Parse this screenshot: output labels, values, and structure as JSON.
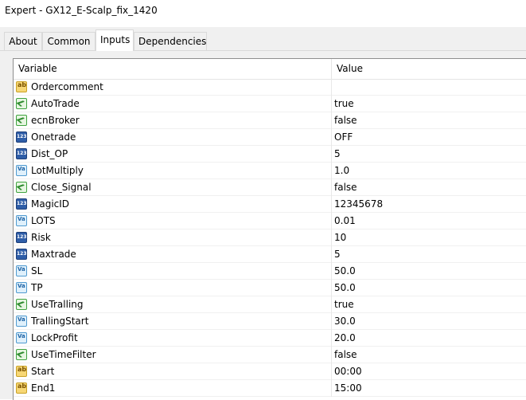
{
  "window": {
    "title": "Expert - GX12_E-Scalp_fix_1420"
  },
  "tabs": [
    {
      "label": "About",
      "active": false
    },
    {
      "label": "Common",
      "active": false
    },
    {
      "label": "Inputs",
      "active": true
    },
    {
      "label": "Dependencies",
      "active": false
    }
  ],
  "table": {
    "headers": {
      "variable": "Variable",
      "value": "Value"
    },
    "rows": [
      {
        "name": "Ordercomment",
        "value": "",
        "icon": "string-icon"
      },
      {
        "name": "AutoTrade",
        "value": "true",
        "icon": "bool-icon"
      },
      {
        "name": "ecnBroker",
        "value": "false",
        "icon": "bool-icon"
      },
      {
        "name": "Onetrade",
        "value": "OFF",
        "icon": "int-icon"
      },
      {
        "name": "Dist_OP",
        "value": "5",
        "icon": "int-icon"
      },
      {
        "name": "LotMultiply",
        "value": "1.0",
        "icon": "double-icon"
      },
      {
        "name": "Close_Signal",
        "value": "false",
        "icon": "bool-icon"
      },
      {
        "name": "MagicID",
        "value": "12345678",
        "icon": "int-icon"
      },
      {
        "name": "LOTS",
        "value": "0.01",
        "icon": "double-icon"
      },
      {
        "name": "Risk",
        "value": "10",
        "icon": "int-icon"
      },
      {
        "name": "Maxtrade",
        "value": "5",
        "icon": "int-icon"
      },
      {
        "name": "SL",
        "value": "50.0",
        "icon": "double-icon"
      },
      {
        "name": "TP",
        "value": "50.0",
        "icon": "double-icon"
      },
      {
        "name": "UseTralling",
        "value": "true",
        "icon": "bool-icon"
      },
      {
        "name": "TrallingStart",
        "value": "30.0",
        "icon": "double-icon"
      },
      {
        "name": "LockProfit",
        "value": "20.0",
        "icon": "double-icon"
      },
      {
        "name": "UseTimeFilter",
        "value": "false",
        "icon": "bool-icon"
      },
      {
        "name": "Start",
        "value": "00:00",
        "icon": "string-icon"
      },
      {
        "name": "End1",
        "value": "15:00",
        "icon": "string-icon"
      }
    ]
  }
}
